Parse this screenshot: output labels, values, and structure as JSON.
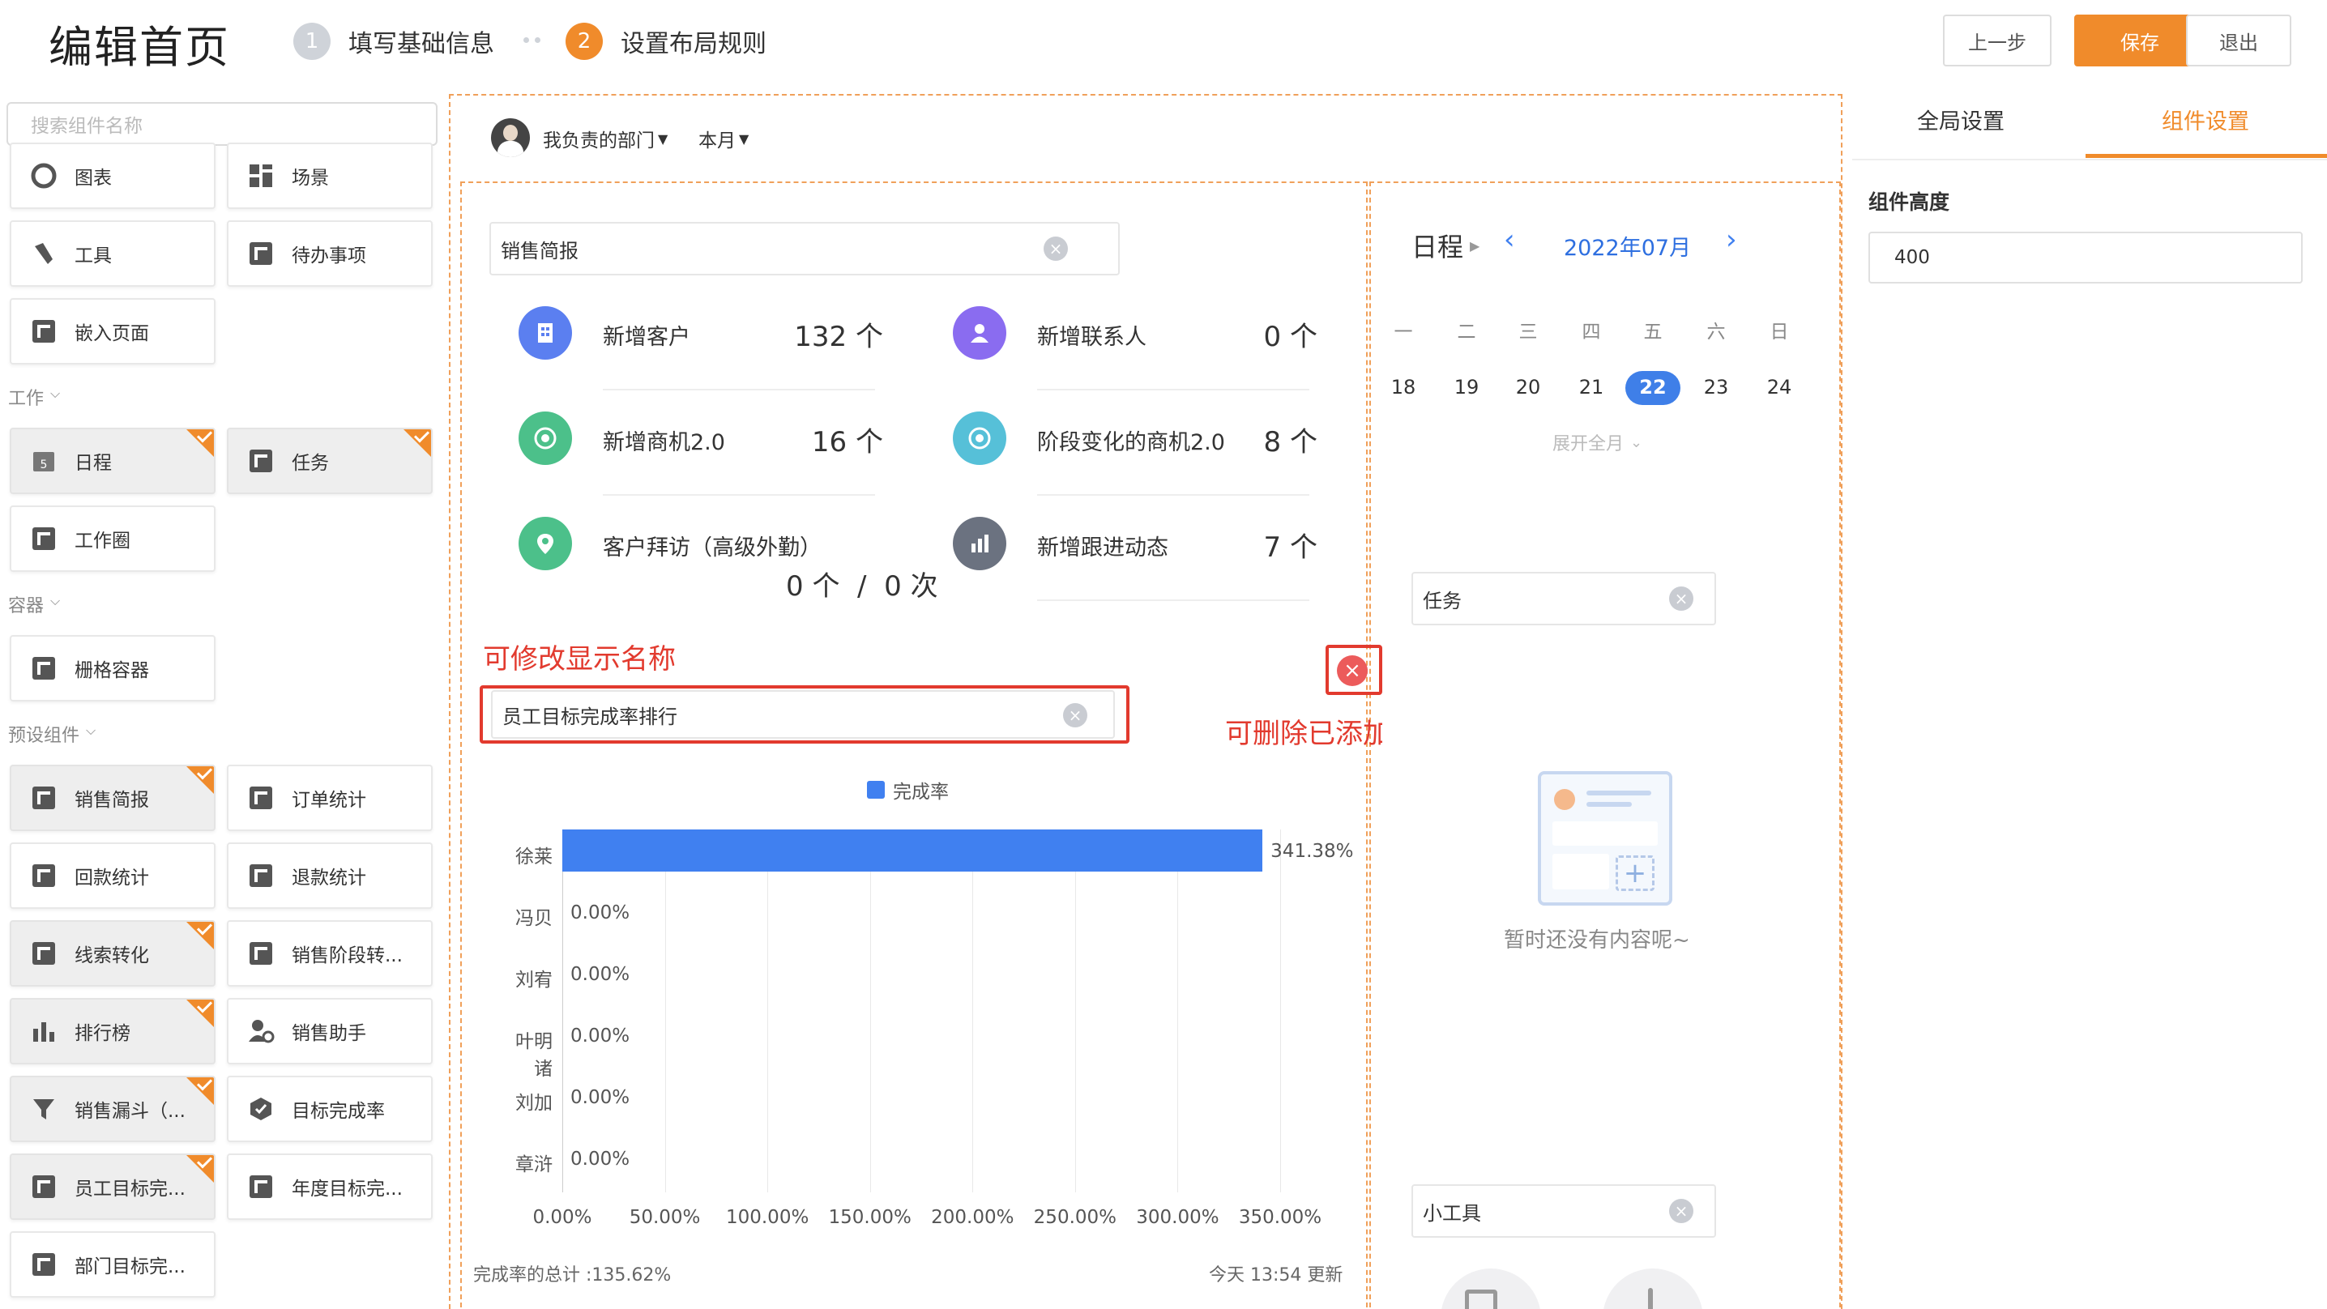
{
  "header": {
    "title": "编辑首页",
    "steps": [
      {
        "num": "1",
        "label": "填写基础信息"
      },
      {
        "num": "2",
        "label": "设置布局规则"
      }
    ],
    "buttons": {
      "prev": "上一步",
      "save": "保存",
      "exit": "退出"
    },
    "accent": "#f08b2b"
  },
  "left": {
    "search_placeholder": "搜索组件名称",
    "items_top": [
      {
        "label": "图表",
        "icon": "chart-icon"
      },
      {
        "label": "场景",
        "icon": "scene-icon"
      },
      {
        "label": "工具",
        "icon": "tool-icon"
      },
      {
        "label": "待办事项",
        "icon": "widget-icon"
      },
      {
        "label": "嵌入页面",
        "icon": "widget-icon"
      }
    ],
    "groups": {
      "work": "工作",
      "container": "容器",
      "preset": "预设组件"
    },
    "work_items": [
      {
        "label": "日程",
        "added": true
      },
      {
        "label": "任务",
        "added": true
      },
      {
        "label": "工作圈",
        "added": false
      }
    ],
    "container_items": [
      {
        "label": "栅格容器",
        "added": false
      }
    ],
    "preset_items": [
      {
        "label": "销售简报",
        "added": true
      },
      {
        "label": "订单统计",
        "added": false
      },
      {
        "label": "回款统计",
        "added": false
      },
      {
        "label": "退款统计",
        "added": false
      },
      {
        "label": "线索转化",
        "added": true
      },
      {
        "label": "销售阶段转...",
        "added": false
      },
      {
        "label": "排行榜",
        "added": true
      },
      {
        "label": "销售助手",
        "added": false
      },
      {
        "label": "销售漏斗（...",
        "added": true
      },
      {
        "label": "目标完成率",
        "added": false
      },
      {
        "label": "员工目标完...",
        "added": true
      },
      {
        "label": "年度目标完...",
        "added": false
      },
      {
        "label": "部门目标完...",
        "added": false
      }
    ]
  },
  "filters": {
    "dept": "我负责的部门",
    "period": "本月"
  },
  "sales": {
    "title": "销售简报",
    "stats": [
      {
        "label": "新增客户",
        "value": "132 个",
        "color": "#5b7ff0"
      },
      {
        "label": "新增联系人",
        "value": "0 个",
        "color": "#8a6cf0"
      },
      {
        "label": "新增商机2.0",
        "value": "16 个",
        "color": "#4cc08a"
      },
      {
        "label": "阶段变化的商机2.0",
        "value": "8 个",
        "color": "#56c0d8"
      },
      {
        "label": "客户拜访（高级外勤）",
        "value": "0 个  /  0 次",
        "color": "#4cc08a"
      },
      {
        "label": "新增跟进动态",
        "value": "7 个",
        "color": "#6b7280"
      }
    ]
  },
  "annotations": {
    "rename": "可修改显示名称",
    "delete": "可删除已添加的组件",
    "color": "#e23a2e"
  },
  "ranking": {
    "title": "员工目标完成率排行",
    "footer_total": "完成率的总计 :135.62%",
    "footer_time": "今天 13:54 更新"
  },
  "chart_data": {
    "type": "bar",
    "orientation": "horizontal",
    "categories": [
      "徐莱",
      "冯贝",
      "刘宥",
      "叶明诸",
      "刘加",
      "章浒"
    ],
    "series": [
      {
        "name": "完成率",
        "values": [
          341.38,
          0,
          0,
          0,
          0,
          0
        ],
        "color": "#4080f0"
      }
    ],
    "value_labels": [
      "341.38%",
      "0.00%",
      "0.00%",
      "0.00%",
      "0.00%",
      "0.00%"
    ],
    "x_ticks": [
      "0.00%",
      "50.00%",
      "100.00%",
      "150.00%",
      "200.00%",
      "250.00%",
      "300.00%",
      "350.00%"
    ],
    "xlim": [
      0,
      350
    ],
    "legend": "top-center",
    "grid": true
  },
  "schedule": {
    "title": "日程",
    "month": "2022年07月",
    "weekdays": [
      "一",
      "二",
      "三",
      "四",
      "五",
      "六",
      "日"
    ],
    "days": [
      "18",
      "19",
      "20",
      "21",
      "22",
      "23",
      "24"
    ],
    "today": "22",
    "expand": "展开全月"
  },
  "task": {
    "title": "任务",
    "empty": "暂时还没有内容呢~"
  },
  "tools": {
    "title": "小工具"
  },
  "right": {
    "tabs": [
      "全局设置",
      "组件设置"
    ],
    "active_tab": 1,
    "height_label": "组件高度",
    "height_value": "400"
  }
}
